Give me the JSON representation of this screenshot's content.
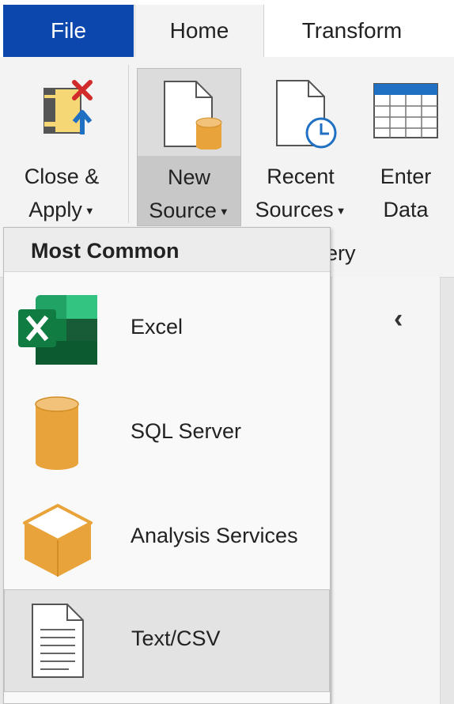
{
  "tabs": {
    "file": "File",
    "home": "Home",
    "transform": "Transform"
  },
  "ribbon": {
    "close_apply": {
      "line1": "Close &",
      "line2": "Apply"
    },
    "new_source": {
      "line1": "New",
      "line2": "Source"
    },
    "recent_sources": {
      "line1": "Recent",
      "line2": "Sources"
    },
    "enter_data": {
      "line1": "Enter",
      "line2": "Data"
    },
    "group_label_partial": "ery",
    "caret": "▼"
  },
  "dropdown": {
    "header": "Most Common",
    "items": [
      {
        "label": "Excel",
        "icon": "excel-icon"
      },
      {
        "label": "SQL Server",
        "icon": "database-icon"
      },
      {
        "label": "Analysis Services",
        "icon": "cube-icon"
      },
      {
        "label": "Text/CSV",
        "icon": "text-file-icon"
      }
    ]
  },
  "pane": {
    "collapse_glyph": "‹"
  },
  "colors": {
    "file_tab": "#0b47ad",
    "excel_green": "#107c41",
    "db_orange": "#e8a33a",
    "accent_blue": "#1f6fc3",
    "close_red": "#d12b2b"
  }
}
